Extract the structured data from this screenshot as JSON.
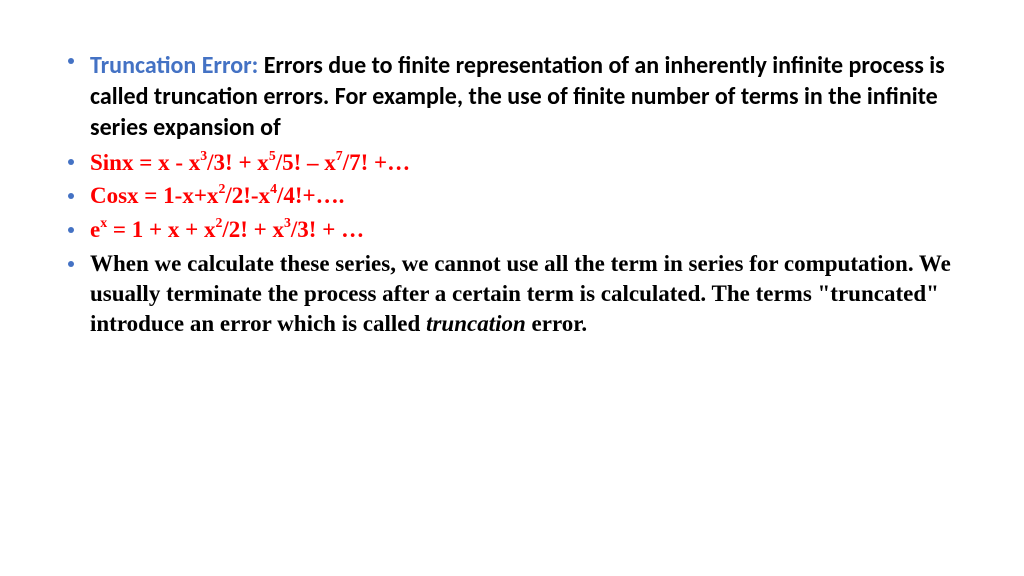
{
  "bullets": {
    "intro_label": "Truncation Error: ",
    "intro_text": "Errors due to finite representation of an inherently infinite process is called truncation errors. For example, the use of finite number of terms in the infinite series expansion of",
    "sin": {
      "prefix": "Sinx = x - x",
      "p1": "3",
      "m1": "/3! + x",
      "p2": "5",
      "m2": "/5! – x",
      "p3": "7",
      "m3": "/7! +…"
    },
    "cos": {
      "prefix": "Cosx = 1-x+x",
      "p1": "2",
      "m1": "/2!-x",
      "p2": "4",
      "m2": "/4!+…."
    },
    "exp": {
      "e": "e",
      "px": "x",
      "eq": " = 1 + x + x",
      "p1": "2",
      "m1": "/2! + x",
      "p2": "3",
      "m2": "/3! + …"
    },
    "explain_pre": "When we calculate these series, we cannot use all the term in series for computation. We usually terminate the process after a certain term is calculated. The terms \"truncated\" introduce an error which is called ",
    "explain_italic": "truncation",
    "explain_post": " error."
  }
}
